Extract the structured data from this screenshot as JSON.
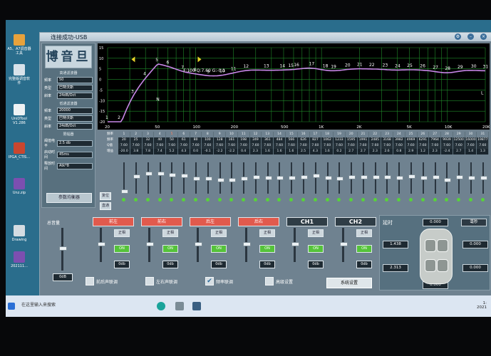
{
  "window_title": "连接成功-USB",
  "desktop": {
    "icons": [
      {
        "label": "A5、A7调音器工具"
      },
      {
        "label": "完整版调音软件"
      },
      {
        "label": "UniDTool V1.286"
      },
      {
        "label": "IPGA_CTIS..."
      },
      {
        "label": "Unz.zip"
      },
      {
        "label": "Drawing"
      },
      {
        "label": "202111..."
      }
    ]
  },
  "logo_text": "博音旦",
  "left_panel": {
    "hp_title": "高通滤波器",
    "hp_rows": [
      {
        "label": "频率",
        "value": "50"
      },
      {
        "label": "类型",
        "value": "巴特沃斯"
      },
      {
        "label": "斜率",
        "value": "24dB/Oct"
      }
    ],
    "lp_title": "低通滤波器",
    "lp_rows": [
      {
        "label": "频率",
        "value": "20000"
      },
      {
        "label": "类型",
        "value": "巴特沃斯"
      },
      {
        "label": "斜率",
        "value": "24dB/Oct"
      }
    ],
    "limiter_title": "限幅器",
    "limiter_rows": [
      {
        "label": "阈值电平",
        "value": "2.5 db"
      },
      {
        "label": "启动时间",
        "value": "45ms"
      },
      {
        "label": "释放时间",
        "value": "Atk*8"
      }
    ],
    "eq_button": "参数均衡器"
  },
  "graph": {
    "point_label": "F:100 Q:7.60 G:-0.1",
    "x_ticks": [
      "20",
      "50",
      "100",
      "200",
      "500",
      "1K",
      "2K",
      "5K",
      "10K",
      "20KHz"
    ],
    "y_ticks": [
      "15",
      "10",
      "5",
      "0",
      "-5",
      "-10",
      "-15",
      "-20"
    ],
    "band_markers": [
      "1",
      "2",
      "3",
      "4",
      "5",
      "6",
      "7",
      "8",
      "9",
      "10",
      "11",
      "12",
      "13",
      "14",
      "15",
      "16",
      "17",
      "18",
      "19",
      "20",
      "21",
      "22",
      "23",
      "24",
      "25",
      "26",
      "27",
      "28",
      "29",
      "30",
      "31"
    ],
    "markers_NL": [
      "N",
      "L"
    ]
  },
  "band_table": {
    "label_band": "频率",
    "label_freq": "频率",
    "label_q": "Q值",
    "label_gain": "增益",
    "numbers": [
      "1",
      "2",
      "3",
      "4",
      "5",
      "6",
      "7",
      "8",
      "9",
      "10",
      "11",
      "12",
      "13",
      "14",
      "15",
      "16",
      "17",
      "18",
      "19",
      "20",
      "21",
      "22",
      "23",
      "24",
      "25",
      "26",
      "27",
      "28",
      "29",
      "30",
      "31"
    ],
    "freqs": [
      "20",
      "25",
      "32",
      "40",
      "50",
      "61",
      "80",
      "100",
      "128",
      "161",
      "198",
      "249",
      "361",
      "484",
      "566",
      "626",
      "827",
      "1062",
      "1233",
      "1595",
      "1991",
      "2485",
      "3168",
      "3982",
      "4969",
      "6291",
      "7964",
      "9939",
      "12500",
      "16000",
      "19877"
    ],
    "qs": [
      "7.60",
      "7.60",
      "7.60",
      "7.60",
      "7.60",
      "7.60",
      "7.60",
      "7.60",
      "7.60",
      "7.60",
      "7.60",
      "7.60",
      "7.60",
      "7.60",
      "7.60",
      "7.60",
      "7.60",
      "7.60",
      "7.60",
      "7.60",
      "7.60",
      "7.60",
      "7.60",
      "7.60",
      "7.60",
      "7.60",
      "7.60",
      "7.60",
      "7.60",
      "7.60",
      "7.60"
    ],
    "gains": [
      "-20.0",
      "3.8",
      "7.8",
      "7.4",
      "5.2",
      "4.3",
      "0.0",
      "-0.1",
      "-2.2",
      "-2.2",
      "0.4",
      "2.3",
      "1.6",
      "1.6",
      "1.6",
      "2.5",
      "4.3",
      "1.6",
      "0.2",
      "2.7",
      "2.7",
      "2.3",
      "2.6",
      "0.8",
      "2.9",
      "1.2",
      "2.3",
      "-2.4",
      "2.7",
      "1.4",
      "1.3"
    ],
    "reset_button": "复位",
    "direct_button": "直通"
  },
  "channels": {
    "master_label": "总音量",
    "master_value": "0dB",
    "items": [
      {
        "name": "前左",
        "mode": "正相",
        "state": "ON",
        "value": "0db"
      },
      {
        "name": "前右",
        "mode": "正相",
        "state": "ON",
        "value": "0db"
      },
      {
        "name": "后左",
        "mode": "正相",
        "state": "ON",
        "value": "0db"
      },
      {
        "name": "后右",
        "mode": "正相",
        "state": "ON",
        "value": "0db"
      },
      {
        "name": "CH1",
        "mode": "正相",
        "state": "ON",
        "value": "0db"
      },
      {
        "name": "CH2",
        "mode": "正相",
        "state": "ON",
        "value": "0db"
      }
    ]
  },
  "checkboxes": [
    {
      "label": "前后声联调",
      "checked": false
    },
    {
      "label": "左右声联调",
      "checked": false
    },
    {
      "label": "频率联调",
      "checked": true
    },
    {
      "label": "高级设置",
      "checked": false
    }
  ],
  "system_button": "系统设置",
  "delay": {
    "title": "延时",
    "unit_select": "毫秒",
    "front_center": "0.000",
    "front_left": "1.438",
    "front_right": "0.000",
    "rear_left": "2.313",
    "rear_right": "0.000",
    "rear_center": "0.000"
  },
  "taskbar": {
    "search_placeholder": "在这里输入来搜索",
    "time": "1:",
    "date": "2021"
  }
}
